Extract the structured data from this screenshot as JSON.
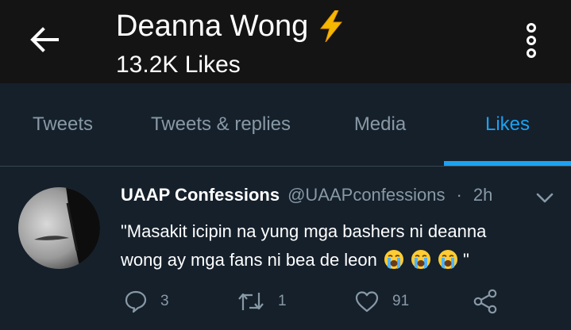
{
  "header": {
    "title": "Deanna Wong",
    "title_emoji": "lightning-icon",
    "subtitle": "13.2K Likes",
    "background": "#141414"
  },
  "tabs": [
    {
      "label": "Tweets",
      "active": false
    },
    {
      "label": "Tweets & replies",
      "active": false
    },
    {
      "label": "Media",
      "active": false
    },
    {
      "label": "Likes",
      "active": true
    }
  ],
  "colors": {
    "accent": "#1da1f2",
    "background": "#15202b",
    "muted": "#8899a6",
    "divider": "#38444d"
  },
  "tweet": {
    "name": "UAAP Confessions",
    "handle": "@UAAPconfessions",
    "separator": "·",
    "time": "2h",
    "text_line1": "\"Masakit icipin na yung mga bashers ni deanna",
    "text_line2": "wong ay mga fans ni bea de leon",
    "text_end": " \"",
    "emojis": [
      "loudly-crying-face-icon",
      "loudly-crying-face-icon",
      "loudly-crying-face-icon"
    ],
    "actions": {
      "reply_count": "3",
      "retweet_count": "1",
      "like_count": "91"
    }
  }
}
